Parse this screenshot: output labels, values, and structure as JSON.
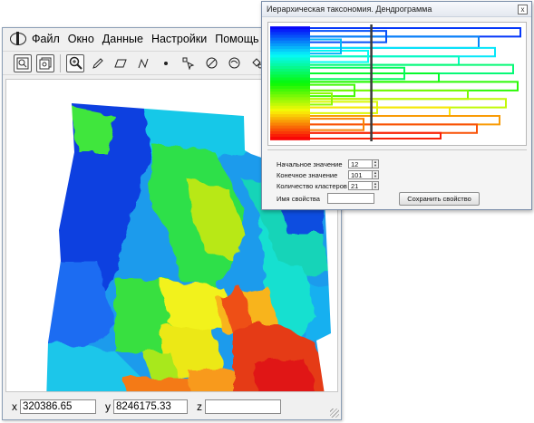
{
  "main_window": {
    "menu": [
      "Файл",
      "Окно",
      "Данные",
      "Настройки",
      "Помощь"
    ],
    "toolbar_icons": [
      "map-view-icon",
      "layers-icon",
      "zoom-icon",
      "pencil-icon",
      "polygon-icon",
      "polyline-icon",
      "point-icon",
      "select-arrow-icon",
      "circle-select-icon",
      "lasso-icon",
      "move-icon",
      "vertex-icon"
    ],
    "status": {
      "x_label": "x",
      "x_value": "320386.65",
      "y_label": "y",
      "y_value": "8246175.33",
      "z_label": "z",
      "z_value": ""
    }
  },
  "dendrogram_dialog": {
    "title": "Иерархическая таксономия. Дендрограмма",
    "close_label": "x",
    "start_label": "Начальное значение",
    "start_value": "12",
    "end_label": "Конечное значение",
    "end_value": "101",
    "clusters_label": "Количество кластеров",
    "clusters_value": "21",
    "property_label": "Имя свойства",
    "property_value": "",
    "save_button": "Сохранить свойство",
    "cut_level_fraction": 0.4
  },
  "colors": {
    "window_border": "#7a8da8",
    "cut_line": "#3a3a3a",
    "map_palette": [
      "#0b2cd8",
      "#1f6cf0",
      "#18b8f0",
      "#18e2c8",
      "#3ee63a",
      "#a8e81c",
      "#f2f21a",
      "#f8b41a",
      "#f47a18",
      "#e83818",
      "#e01818"
    ]
  }
}
